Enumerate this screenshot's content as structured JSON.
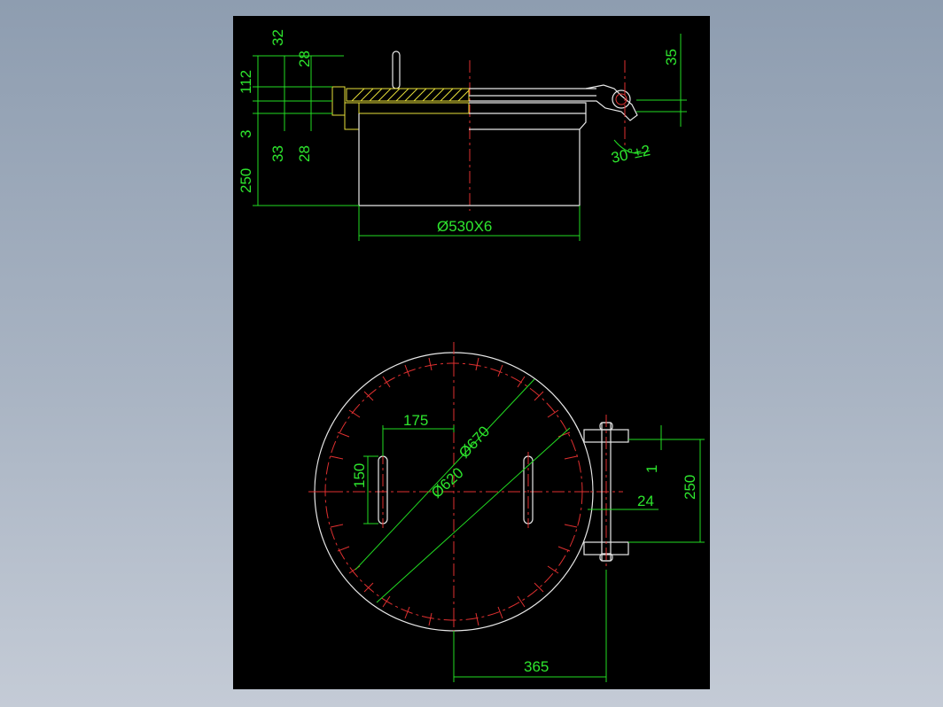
{
  "sheet": {
    "background": "#000000",
    "outline_color": "#e8e8e8",
    "dimension_color": "#2ee62e",
    "centerline_color": "#e03030",
    "hatch_color": "#e8e03a"
  },
  "section_view": {
    "dims": {
      "d32": "32",
      "d28_top": "28",
      "d112": "112",
      "d3": "3",
      "d33": "33",
      "d28_bottom": "28",
      "d250": "250",
      "d35": "35",
      "angle": "30°±2",
      "diameter": "Ø530X6"
    }
  },
  "plan_view": {
    "dims": {
      "d175": "175",
      "d150": "150",
      "phi670": "Ø670",
      "phi620": "Ø620",
      "d1": "1",
      "d24": "24",
      "d250": "250",
      "d365": "365"
    }
  }
}
